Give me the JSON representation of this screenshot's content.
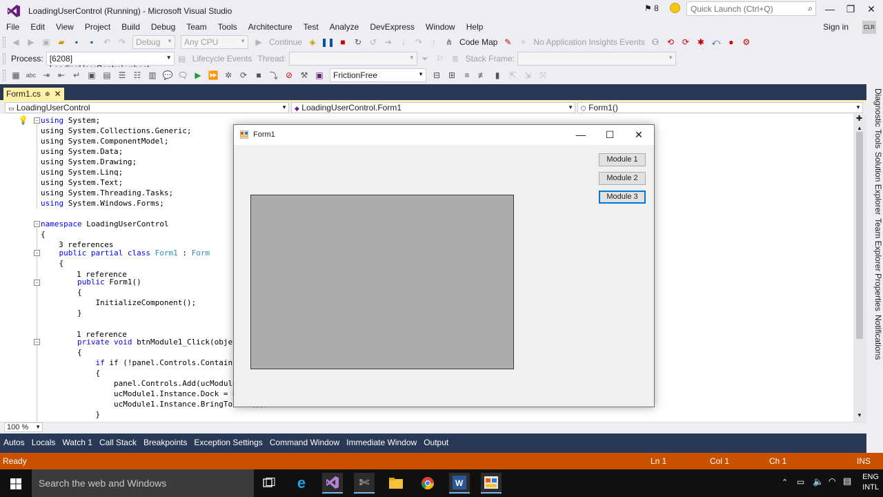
{
  "window": {
    "title": "LoadingUserControl (Running) - Microsoft Visual Studio",
    "notification_count": "8",
    "quick_launch_placeholder": "Quick Launch (Ctrl+Q)",
    "sign_in": "Sign in"
  },
  "menu": [
    "File",
    "Edit",
    "View",
    "Project",
    "Build",
    "Debug",
    "Team",
    "Tools",
    "Architecture",
    "Test",
    "Analyze",
    "DevExpress",
    "Window",
    "Help"
  ],
  "toolbar1": {
    "config": "Debug",
    "platform": "Any CPU",
    "continue": "Continue",
    "code_map": "Code Map",
    "insights": "No Application Insights Events"
  },
  "toolbar2": {
    "process_label": "Process:",
    "process_value": "[6208] LoadingUserControl.vshost.",
    "lifecycle": "Lifecycle Events",
    "thread_label": "Thread:",
    "stack_frame_label": "Stack Frame:"
  },
  "toolbar3": {
    "friction_value": "FrictionFree"
  },
  "tab": {
    "file": "Form1.cs",
    "pin": "ᵒ",
    "close": "✕"
  },
  "nav": {
    "project": "LoadingUserControl",
    "type": "LoadingUserControl.Form1",
    "member": "Form1()"
  },
  "code": {
    "line_using_system": "System;",
    "usings_dim": [
      "System.Collections.Generic;",
      "System.ComponentModel;",
      "System.Data;",
      "System.Drawing;",
      "System.Linq;",
      "System.Text;",
      "System.Threading.Tasks;"
    ],
    "using_forms": "System.Windows.Forms;",
    "namespace_name": "LoadingUserControl",
    "refs3": "3 references",
    "class_decl_name": "Form1",
    "class_base": "Form",
    "ref1": "1 reference",
    "ctor": "Form1()",
    "init": "InitializeComponent();",
    "method": "btnModule1_Click(objec",
    "if_line": "if (!panel.Controls.Contains(uc",
    "add_line": "panel.Controls.Add(ucModule",
    "dock_line": "ucModule1.Instance.Dock = D",
    "bring_line": "ucModule1.Instance.BringTo",
    "bring_tail": "();"
  },
  "zoom": "100 %",
  "tool_tabs": [
    "Autos",
    "Locals",
    "Watch 1",
    "Call Stack",
    "Breakpoints",
    "Exception Settings",
    "Command Window",
    "Immediate Window",
    "Output"
  ],
  "side_tabs": [
    "Diagnostic Tools",
    "Solution Explorer",
    "Team Explorer",
    "Properties",
    "Notifications"
  ],
  "status": {
    "state": "Ready",
    "ln": "Ln 1",
    "col": "Col 1",
    "ch": "Ch 1",
    "ins": "INS"
  },
  "form1": {
    "title": "Form1",
    "buttons": [
      "Module 1",
      "Module 2",
      "Module 3"
    ]
  },
  "taskbar": {
    "search_placeholder": "Search the web and Windows",
    "lang1": "ENG",
    "lang2": "INTL"
  },
  "colors": {
    "status_bar": "#ca5100",
    "doc_well": "#293955",
    "active_tab": "#fff1a8",
    "panel": "#acacac"
  }
}
